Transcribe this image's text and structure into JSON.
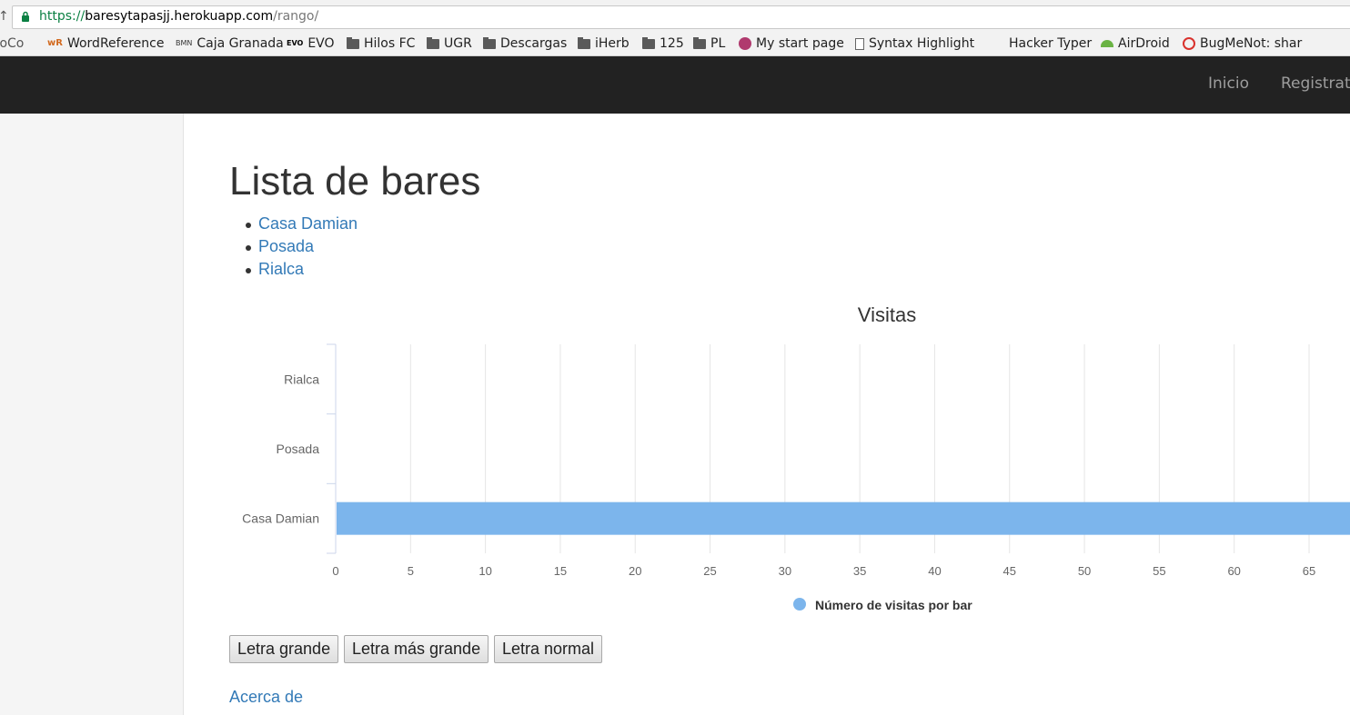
{
  "browser": {
    "url_scheme": "https://",
    "url_host": "baresytapasjj.herokuapp.com",
    "url_path": "/rango/",
    "bookmarks": [
      {
        "label": "roCo",
        "icon": "none"
      },
      {
        "label": "WordReference",
        "icon": "wordreference-icon"
      },
      {
        "label": "Caja Granada",
        "icon": "caja-granada-icon"
      },
      {
        "label": "EVO",
        "icon": "evo-icon"
      },
      {
        "label": "Hilos FC",
        "icon": "folder-icon"
      },
      {
        "label": "UGR",
        "icon": "folder-icon"
      },
      {
        "label": "Descargas",
        "icon": "folder-icon"
      },
      {
        "label": "iHerb",
        "icon": "folder-icon"
      },
      {
        "label": "125",
        "icon": "folder-icon"
      },
      {
        "label": "PL",
        "icon": "folder-icon"
      },
      {
        "label": "My start page",
        "icon": "mystartpage-icon"
      },
      {
        "label": "Syntax Highlight",
        "icon": "page-icon"
      },
      {
        "label": "Hacker Typer",
        "icon": "none"
      },
      {
        "label": "AirDroid",
        "icon": "airdroid-icon"
      },
      {
        "label": "BugMeNot: shar",
        "icon": "bugmenot-icon"
      }
    ]
  },
  "navbar": {
    "links": [
      "Inicio",
      "Registrate"
    ]
  },
  "page": {
    "title": "Lista de bares",
    "bars": [
      "Casa Damian",
      "Posada",
      "Rialca"
    ],
    "buttons": [
      "Letra grande",
      "Letra más grande",
      "Letra normal"
    ],
    "about_link": "Acerca de"
  },
  "colors": {
    "navbar_bg": "#222222",
    "link": "#337ab7",
    "bar_fill": "#7cb5ec"
  },
  "chart_data": {
    "type": "bar",
    "orientation": "horizontal",
    "title": "Visitas",
    "categories": [
      "Casa Damian",
      "Posada",
      "Rialca"
    ],
    "series": [
      {
        "name": "Número de visitas por bar",
        "values": [
          70,
          0,
          0
        ]
      }
    ],
    "x_ticks": [
      0,
      5,
      10,
      15,
      20,
      25,
      30,
      35,
      40,
      45,
      50,
      55,
      60,
      65
    ],
    "xlim": [
      0,
      70
    ],
    "grid": true,
    "legend_position": "bottom-center"
  }
}
